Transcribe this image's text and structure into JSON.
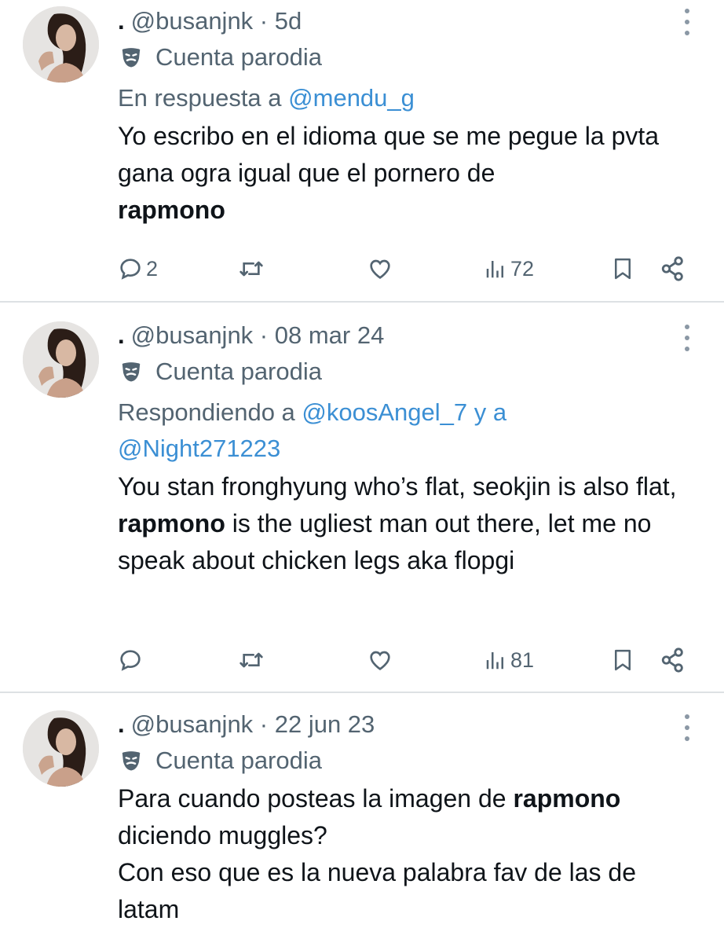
{
  "tweets": [
    {
      "handle_line": "@busanjnk · 5d",
      "parody_label": "Cuenta parodia",
      "reply_prefix": "En respuesta a",
      "reply_mention1": "@mendu_g",
      "reply_mention2": "",
      "text_parts": [
        "Yo escribo en el idioma que se me pegue la pvta gana ogra igual que el pornero de",
        "rapmono",
        ""
      ],
      "replies": "2",
      "views": "72"
    },
    {
      "handle_line": "@busanjnk · 08 mar 24",
      "parody_label": "Cuenta parodia",
      "reply_prefix": "Respondiendo a",
      "reply_mention1": "@koosAngel_7",
      "reply_join": "y a",
      "reply_mention2": "@Night271223",
      "text_parts": [
        "You stan fronghyung who’s flat, seokjin is also flat,",
        "rapmono",
        "is the ugliest man out there, let me no speak about chicken legs aka flopgi"
      ],
      "replies": "",
      "views": "81"
    },
    {
      "handle_line": "@busanjnk · 22 jun 23",
      "parody_label": "Cuenta parodia",
      "text_parts": [
        "Para cuando posteas la imagen de",
        "rapmono",
        "diciendo muggles?"
      ],
      "text_line2": "Con eso que es la nueva palabra fav de las de latam"
    }
  ],
  "bullet": ".",
  "colors": {
    "mention": "#3b8fd4",
    "secondary": "#536471",
    "text": "#0f1419"
  }
}
